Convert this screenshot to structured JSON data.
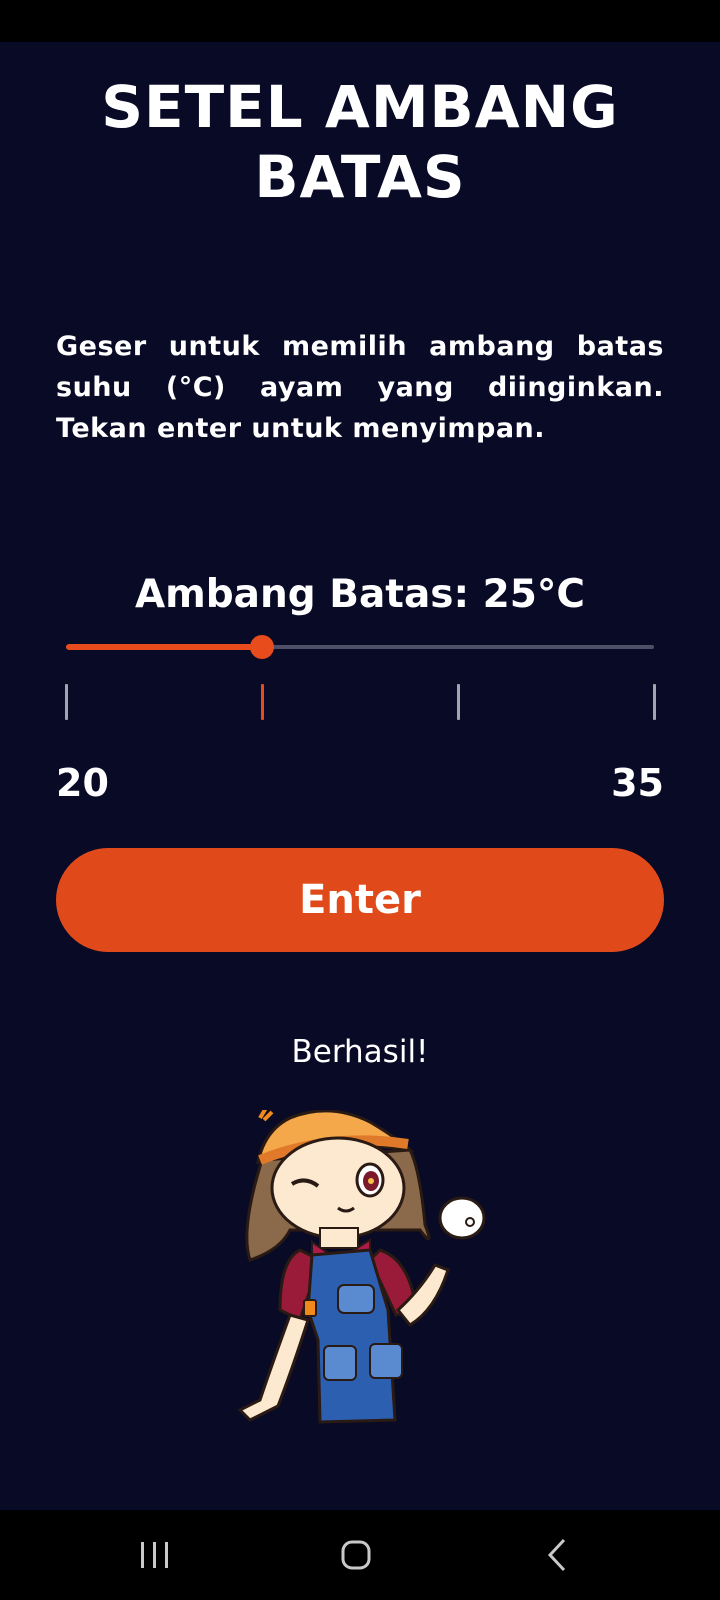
{
  "header": {
    "title": "SETEL AMBANG BATAS"
  },
  "instructions": {
    "text": "Geser untuk memilih ambang batas suhu (°C) ayam yang diinginkan. Tekan enter untuk menyimpan."
  },
  "threshold": {
    "label": "Ambang Batas: 25°C",
    "value": 25,
    "min": 20,
    "max": 35,
    "min_label": "20",
    "max_label": "35",
    "ticks": [
      20,
      25,
      30,
      35
    ]
  },
  "actions": {
    "enter_label": "Enter"
  },
  "status": {
    "message": "Berhasil!"
  },
  "colors": {
    "accent": "#e04a1a",
    "background": "#080a26",
    "track": "#4e4f66"
  },
  "navigation": {
    "icons": [
      "recent-apps-icon",
      "home-icon",
      "back-icon"
    ]
  }
}
